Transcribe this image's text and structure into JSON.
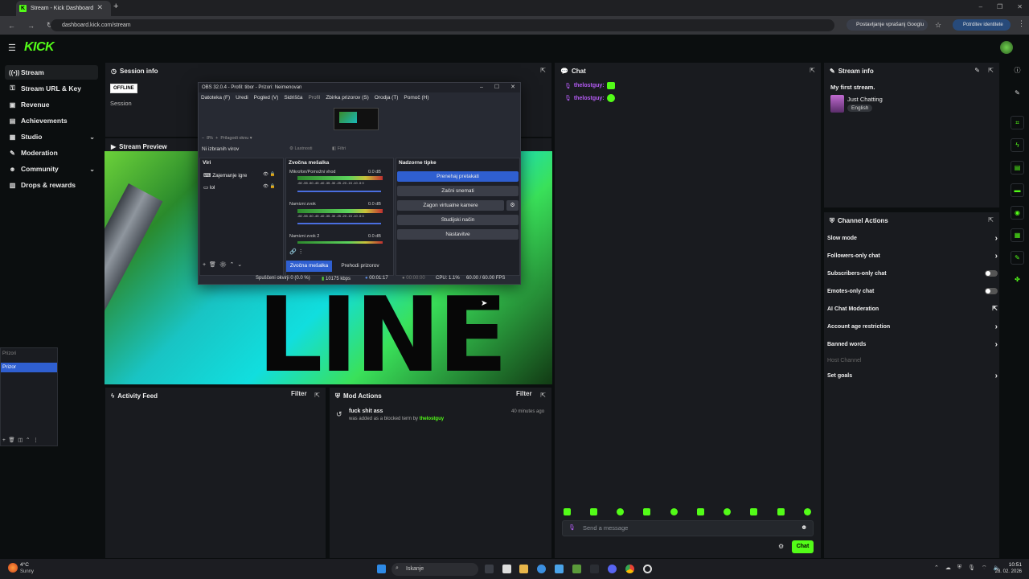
{
  "browser": {
    "tab_title": "Stream - Kick Dashboard",
    "url": "dashboard.kick.com/stream",
    "google_pill": "Postavljanje vprašanj Googlu",
    "identity_pill": "Potrditev identitete"
  },
  "logo": "KICK",
  "sidebar": {
    "items": [
      {
        "label": "Stream",
        "icon": "broadcast-icon",
        "active": true
      },
      {
        "label": "Stream URL & Key",
        "icon": "key-icon"
      },
      {
        "label": "Revenue",
        "icon": "revenue-icon"
      },
      {
        "label": "Achievements",
        "icon": "trophy-icon"
      },
      {
        "label": "Studio",
        "icon": "film-icon",
        "expandable": true
      },
      {
        "label": "Moderation",
        "icon": "wrench-icon"
      },
      {
        "label": "Community",
        "icon": "people-icon",
        "expandable": true
      },
      {
        "label": "Drops & rewards",
        "icon": "gift-icon"
      }
    ]
  },
  "session": {
    "title": "Session info",
    "status": "OFFLINE",
    "label": "Session"
  },
  "preview": {
    "title": "Stream Preview",
    "overlay_text": "LINE"
  },
  "obs": {
    "title": "OBS 32.0.4 - Profil: tibor - Prizori: Neimenovan",
    "menu": [
      "Datoteka (F)",
      "Uredi",
      "Pogled (V)",
      "Sidrišča",
      "Profil",
      "Zbirka prizorov (S)",
      "Orodja (T)",
      "Pomoč (H)"
    ],
    "zoom": "8%",
    "fit": "Prilagodi oknu",
    "no_source": "Ni izbranih virov",
    "props": "Lastnosti",
    "filters": "Filtri",
    "sources_title": "Viri",
    "sources": [
      "Zajemanje igre",
      "lol"
    ],
    "mixer_title": "Zvočna mešalka",
    "channels": [
      {
        "name": "Mikrofon/Pomožni vhod",
        "db": "0.0 dB"
      },
      {
        "name": "Namizni zvok",
        "db": "0.0 dB"
      },
      {
        "name": "Namizni zvok 2",
        "db": "0.0 dB"
      }
    ],
    "scale": "-60 -55 -50 -45 -40 -35 -30 -25 -20 -15 -10 -5 0",
    "tab_mixer": "Zvočna mešalka",
    "tab_transitions": "Prehodi prizorov",
    "controls_title": "Nadzorne tipke",
    "controls": [
      "Prenehaj pretakati",
      "Začni snemati",
      "Zagon virtualne kamere",
      "Studijski način",
      "Nastavitve"
    ],
    "status": {
      "dropped": "Spuščeni okvirji 0 (0.0 %)",
      "kbps": "10175 kbps",
      "stream_time": "00:01:17",
      "rec_time": "00:00:00",
      "cpu": "CPU: 1.1%",
      "fps": "60.00 / 60.00 FPS"
    }
  },
  "mini_window": {
    "header": "Prizori",
    "item": "Prizor"
  },
  "activity": {
    "title": "Activity Feed",
    "filter": "Filter"
  },
  "mod": {
    "title": "Mod Actions",
    "filter": "Filter",
    "entries": [
      {
        "term": "fuck shit ass",
        "text": "was added as a blocked term by",
        "user": "thelostguy",
        "time": "40 minutes ago"
      }
    ]
  },
  "chat": {
    "title": "Chat",
    "messages": [
      {
        "user": "thelostguy:"
      },
      {
        "user": "thelostguy:"
      }
    ],
    "placeholder": "Send a message",
    "send": "Chat"
  },
  "stream_info": {
    "title": "Stream info",
    "stream_title": "My first stream.",
    "category": "Just Chatting",
    "language": "English"
  },
  "channel_actions": {
    "title": "Channel Actions",
    "items": [
      {
        "label": "Slow mode",
        "control": "arrow"
      },
      {
        "label": "Followers-only chat",
        "control": "arrow"
      },
      {
        "label": "Subscribers-only chat",
        "control": "toggle"
      },
      {
        "label": "Emotes-only chat",
        "control": "toggle"
      },
      {
        "label": "AI Chat Moderation",
        "control": "external"
      },
      {
        "label": "Account age restriction",
        "control": "arrow"
      },
      {
        "label": "Banned words",
        "control": "arrow"
      },
      {
        "label": "Host Channel",
        "control": "none",
        "disabled": true
      },
      {
        "label": "Set goals",
        "control": "arrow"
      }
    ]
  },
  "taskbar": {
    "weather_temp": "4°C",
    "weather_desc": "Sunny",
    "search": "Iskanje",
    "time": "10:51",
    "date": "28. 02. 2026"
  },
  "colors": {
    "accent": "#53fc18",
    "panel": "#191b1f",
    "background": "#0b0e0f",
    "obs_blue": "#2f5fd0"
  }
}
